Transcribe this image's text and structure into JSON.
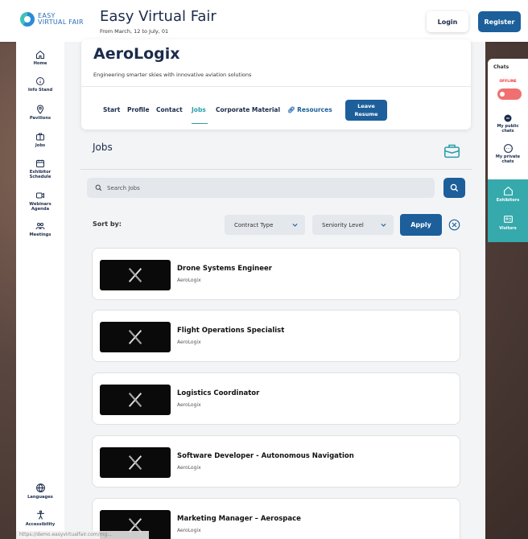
{
  "header": {
    "logo_line1": "EASY",
    "logo_line2": "VIRTUAL FAIR",
    "title": "Easy Virtual Fair",
    "subtitle": "From March, 12 to July, 01",
    "login_label": "Login",
    "register_label": "Register"
  },
  "sidebar": {
    "items": [
      {
        "label": "Home",
        "icon": "home-icon"
      },
      {
        "label": "Info Stand",
        "icon": "info-icon"
      },
      {
        "label": "Pavilions",
        "icon": "location-pin-icon"
      },
      {
        "label": "Jobs",
        "icon": "briefcase-icon"
      },
      {
        "label": "Exhibitor Schedule",
        "icon": "calendar-icon"
      },
      {
        "label": "Webinars Agenda",
        "icon": "video-icon"
      },
      {
        "label": "Meetings",
        "icon": "people-icon"
      },
      {
        "label": "Languages",
        "icon": "globe-icon"
      },
      {
        "label": "Accessibility",
        "icon": "accessibility-icon"
      }
    ]
  },
  "company": {
    "name": "AeroLogix",
    "tagline": "Engineering smarter skies with innovative aviation solutions",
    "tabs": [
      "Start",
      "Profile",
      "Contact",
      "Jobs",
      "Corporate Material",
      "Resources"
    ],
    "active_tab": "Jobs",
    "leave_resume_line1": "Leave",
    "leave_resume_line2": "Resume"
  },
  "jobs": {
    "section_title": "Jobs",
    "search_placeholder": "Search Jobs",
    "sort_label": "Sort by:",
    "contract_type_label": "Contract Type",
    "seniority_level_label": "Seniority Level",
    "apply_label": "Apply",
    "listings": [
      {
        "title": "Drone Systems Engineer",
        "company": "AeroLogix"
      },
      {
        "title": "Flight Operations Specialist",
        "company": "AeroLogix"
      },
      {
        "title": "Logistics Coordinator",
        "company": "AeroLogix"
      },
      {
        "title": "Software Developer - Autonomous Navigation",
        "company": "AeroLogix"
      },
      {
        "title": "Marketing Manager – Aerospace",
        "company": "AeroLogix"
      }
    ]
  },
  "chats": {
    "title": "Chats",
    "status": "OFFLINE",
    "public_line1": "My public",
    "public_line2": "chats",
    "private_line1": "My private",
    "private_line2": "chats",
    "exhibitors_label": "Exhibitors",
    "visitors_label": "Visitors"
  },
  "status_url": "https://demo.easyvirtualfair.com/mg...",
  "colors": {
    "primary": "#1c5f9a",
    "accent_teal": "#35a9ac",
    "navy_text": "#1b2b4a",
    "offline_red": "#e33333"
  }
}
